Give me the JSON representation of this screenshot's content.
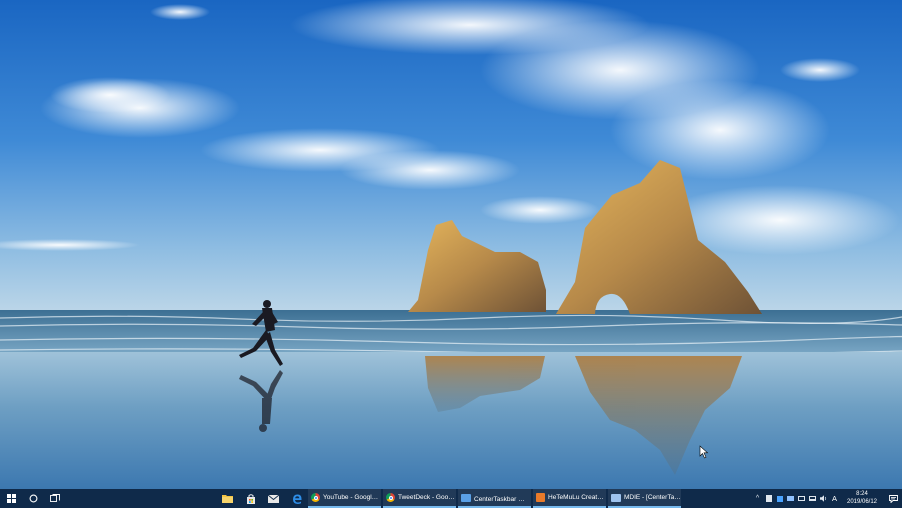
{
  "taskbar": {
    "start_label": "Start",
    "search_label": "Search",
    "task_view_label": "Task View",
    "pinned": [
      {
        "name": "file-explorer-icon",
        "color": "#f3c343"
      },
      {
        "name": "store-icon",
        "color": "#e8e8e8"
      },
      {
        "name": "mail-icon",
        "color": "#e8e8e8"
      },
      {
        "name": "edge-icon",
        "color": "#2e8ee8"
      }
    ],
    "tasks": [
      {
        "label": "YouTube - Google ...",
        "icon": "chrome-icon",
        "color": "#e5a23a"
      },
      {
        "label": "TweetDeck - Googl...",
        "icon": "chrome-icon",
        "color": "#e5a23a"
      },
      {
        "label": "CenterTaskbar のダ...",
        "icon": "app-icon",
        "color": "#5aa0e6"
      },
      {
        "label": "HeTeMuLu Creator ...",
        "icon": "app-icon",
        "color": "#e87a2a"
      },
      {
        "label": "MDIE - [CenterTask...",
        "icon": "app-icon",
        "color": "#9ec3ee"
      }
    ],
    "tray": {
      "ime": "A",
      "time": "8:24",
      "date": "2019/06/12"
    }
  },
  "wallpaper": {
    "sky_top": "#1f6fc6",
    "sky_horizon": "#a7cbe3",
    "sea": "#5d8fb0",
    "sand": "#6fa1c7"
  }
}
